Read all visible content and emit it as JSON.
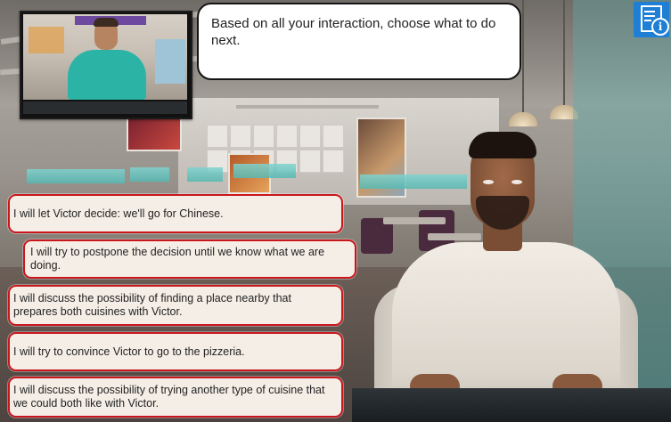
{
  "speech": {
    "text": "Based on all your interaction, choose what to do next."
  },
  "info_button": {
    "icon": "info-document-icon",
    "label": "i",
    "color": "#1f7fd4"
  },
  "options": [
    {
      "label": "I will let Victor decide: we'll go for Chinese."
    },
    {
      "label": "I will try to postpone the decision until we know what we are doing."
    },
    {
      "label": "I will discuss the possibility of finding a place nearby that prepares both cuisines with Victor."
    },
    {
      "label": "I will try to convince Victor to go to the pizzeria."
    },
    {
      "label": "I will discuss the possibility of trying another type of cuisine that we could both like with Victor."
    }
  ],
  "colors": {
    "option_border": "#c9161d",
    "option_background": "#f5eee6",
    "avatar_shirt": "#2bb4a6"
  }
}
